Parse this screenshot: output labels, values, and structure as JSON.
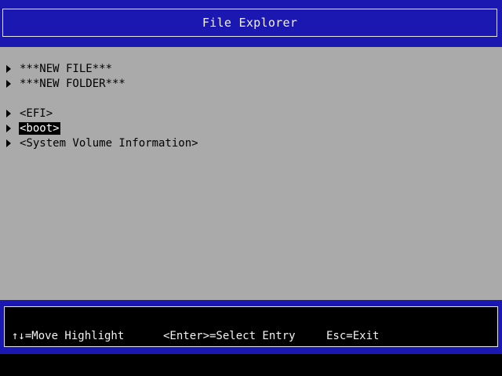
{
  "window": {
    "title": "File Explorer"
  },
  "entries": [
    {
      "label": "***NEW FILE***",
      "highlighted": false
    },
    {
      "label": "***NEW FOLDER***",
      "highlighted": false
    },
    {
      "label": "<EFI>",
      "highlighted": false
    },
    {
      "label": "<boot>",
      "highlighted": true
    },
    {
      "label": "<System Volume Information>",
      "highlighted": false
    }
  ],
  "footer": {
    "hint_move": "↑↓=Move Highlight",
    "hint_select": "<Enter>=Select Entry",
    "hint_exit": "Esc=Exit"
  },
  "colors": {
    "header_blue": "#1a18b0",
    "panel_gray": "#aaaaaa",
    "highlight_bg": "#000000",
    "highlight_fg": "#ffffff",
    "text": "#000000"
  }
}
